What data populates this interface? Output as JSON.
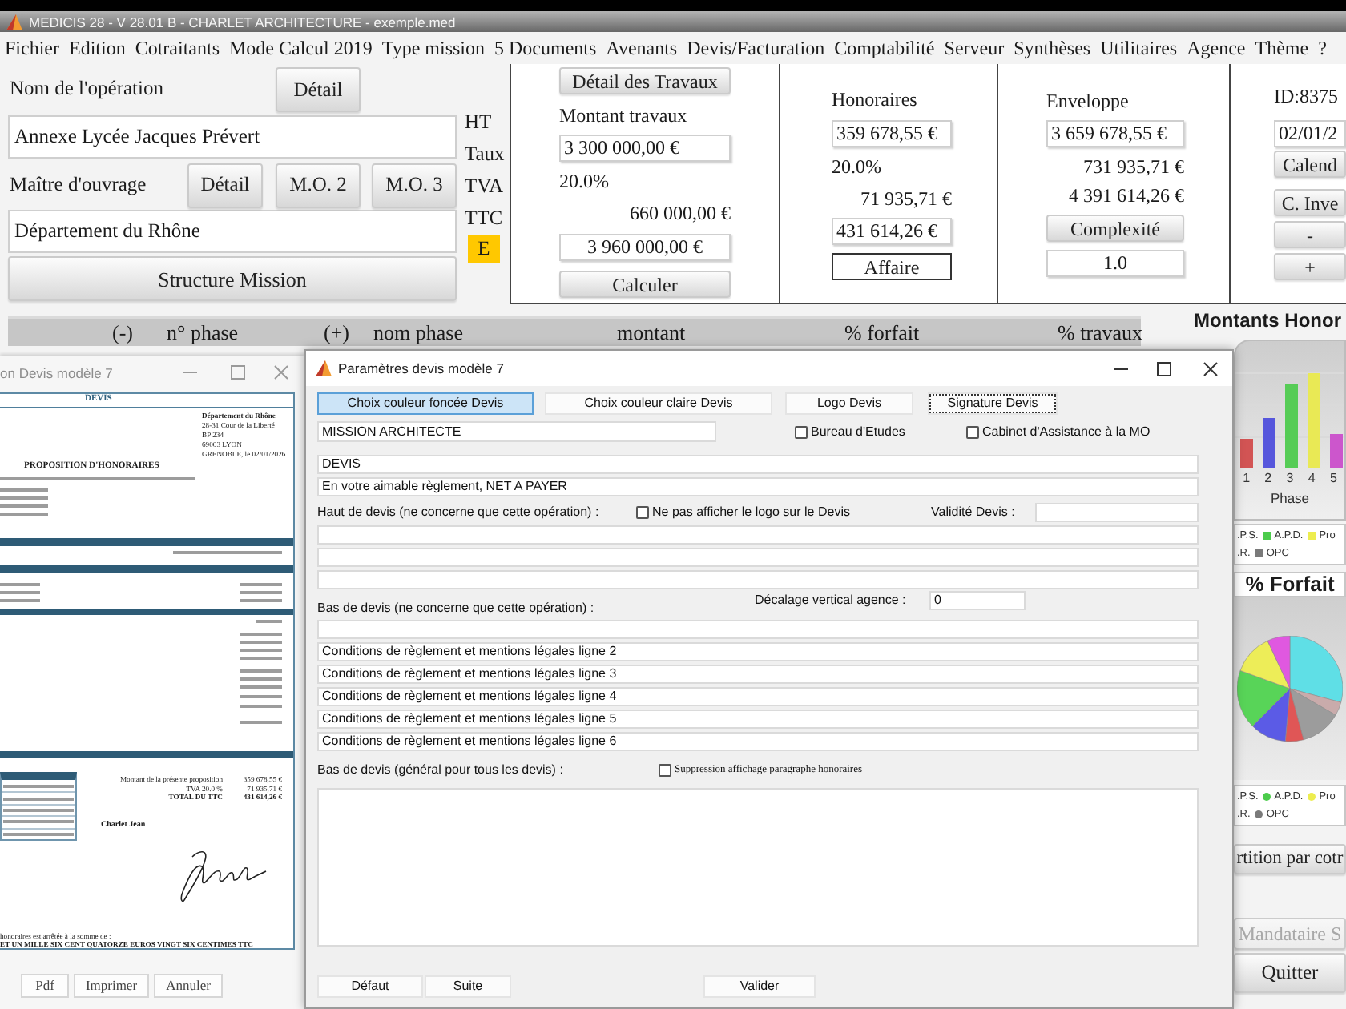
{
  "window": {
    "title": "MEDICIS 28 - V 28.01 B - CHARLET ARCHITECTURE - exemple.med"
  },
  "menu": [
    "Fichier",
    "Edition",
    "Cotraitants",
    "Mode Calcul 2019",
    "Type mission",
    "5 Documents",
    "Avenants",
    "Devis/Facturation",
    "Comptabilité",
    "Serveur",
    "Synthèses",
    "Utilitaires",
    "Agence",
    "Thème",
    "?"
  ],
  "operation": {
    "label": "Nom de l'opération",
    "button": "Détail",
    "value": "Annexe Lycée Jacques Prévert"
  },
  "owner": {
    "label": "Maître d'ouvrage",
    "buttons": [
      "Détail",
      "M.O. 2",
      "M.O. 3"
    ],
    "value": "Département du Rhône"
  },
  "structure_button": "Structure Mission",
  "amount_labels": [
    "HT",
    "Taux",
    "TVA",
    "TTC"
  ],
  "status_flag": "E",
  "works": {
    "button": "Détail des Travaux",
    "label": "Montant travaux",
    "ht": "3 300 000,00 €",
    "rate": "20.0%",
    "tva": "660 000,00 €",
    "ttc": "3 960 000,00 €",
    "calc_button": "Calculer"
  },
  "fees": {
    "label": "Honoraires",
    "ht": "359 678,55 €",
    "rate": "20.0%",
    "tva": "71 935,71 €",
    "ttc": "431 614,26 €",
    "button": "Affaire"
  },
  "envelope": {
    "label": "Enveloppe",
    "ht": "3 659 678,55 €",
    "tva": "731 935,71 €",
    "ttc": "4 391 614,26 €",
    "button": "Complexité",
    "complexity": "1.0"
  },
  "project": {
    "id": "ID:8375",
    "date": "02/01/2",
    "buttons": [
      "Calend",
      "C. Inve",
      "-",
      "+"
    ]
  },
  "table": {
    "columns": [
      "(-)",
      "n° phase",
      "(+)",
      "nom phase",
      "montant",
      "% forfait",
      "% travaux"
    ]
  },
  "side_panel": {
    "title": "Montants Honor",
    "bar_chart": {
      "x_labels": [
        "1",
        "2",
        "3",
        "4",
        "5"
      ],
      "axis_title": "Phase",
      "legend": [
        [
          {
            "label": ".P.S."
          },
          {
            "label": "A.P.D.",
            "color": "#4ccc4c"
          },
          {
            "label": "Pro",
            "color": "#eded4f"
          }
        ],
        [
          {
            "label": ".R."
          },
          {
            "label": "OPC",
            "color": "#7a7a7a"
          }
        ]
      ]
    },
    "pie_chart": {
      "title": "% Forfait",
      "legend": [
        [
          {
            "label": ".P.S."
          },
          {
            "label": "A.P.D.",
            "color": "#4ccc4c"
          },
          {
            "label": "Pro",
            "color": "#eded4f"
          }
        ],
        [
          {
            "label": ".R."
          },
          {
            "label": "OPC",
            "color": "#7a7a7a"
          }
        ]
      ]
    },
    "buttons": [
      {
        "label": "rtition par cotr",
        "disabled": false
      },
      {
        "label": "Mandataire S",
        "disabled": true
      },
      {
        "label": "Quitter",
        "disabled": false
      }
    ]
  },
  "preview_window": {
    "title": "on Devis modèle 7",
    "document": {
      "heading": "DEVIS",
      "recipient": [
        "Département du Rhône",
        "28-31 Cour de la Liberté",
        "BP 234",
        "69003 LYON",
        "GRENOBLE, le 02/01/2026"
      ],
      "title": "PROPOSITION D'HONORAIRES",
      "totals": [
        {
          "label": "Montant de la présente proposition",
          "value": "359 678,55 €"
        },
        {
          "label": "TVA 20.0 %",
          "value": "71 935,71 €"
        },
        {
          "label": "TOTAL DU TTC",
          "value": "431 614,26 €"
        }
      ],
      "signatory": "Charlet Jean",
      "amount_in_words": [
        "honoraires est arrêtée à la somme de :",
        "ET UN MILLE SIX CENT QUATORZE EUROS VINGT SIX CENTIMES TTC"
      ]
    },
    "buttons": [
      "Pdf",
      "Imprimer",
      "Annuler"
    ]
  },
  "dialog": {
    "title": "Paramètres devis modèle 7",
    "buttons": [
      {
        "label": "Choix couleur foncée Devis",
        "highlighted": true,
        "focused": false
      },
      {
        "label": "Choix couleur claire Devis",
        "highlighted": false,
        "focused": false
      },
      {
        "label": "Logo Devis",
        "highlighted": false,
        "focused": false
      },
      {
        "label": "Signature Devis",
        "highlighted": false,
        "focused": true
      }
    ],
    "mission_field": "MISSION ARCHITECTE",
    "options": [
      {
        "label": "Bureau d'Etudes",
        "checked": false
      },
      {
        "label": "Cabinet d'Assistance à la MO",
        "checked": false
      }
    ],
    "title_field": "DEVIS",
    "payment_field": "En votre aimable règlement, NET A PAYER",
    "header_label": "Haut de devis (ne concerne que cette opération) :",
    "hide_logo": {
      "label": "Ne pas afficher le logo sur le Devis",
      "checked": false
    },
    "validity_label": "Validité Devis :",
    "offset_label": "Décalage vertical agence :",
    "offset_value": "0",
    "footer_label": "Bas de devis (ne concerne que cette opération) :",
    "footer_lines": [
      "Conditions de règlement et mentions légales ligne 2",
      "Conditions de règlement et mentions légales ligne 3",
      "Conditions de règlement et mentions légales ligne 4",
      "Conditions de règlement et mentions légales ligne 5",
      "Conditions de règlement et mentions légales ligne 6"
    ],
    "general_footer_label": "Bas de devis (général pour tous les devis) :",
    "hide_fees": {
      "label": "Suppression affichage paragraphe honoraires",
      "checked": false
    },
    "actions": [
      "Défaut",
      "Suite",
      "Valider"
    ]
  }
}
